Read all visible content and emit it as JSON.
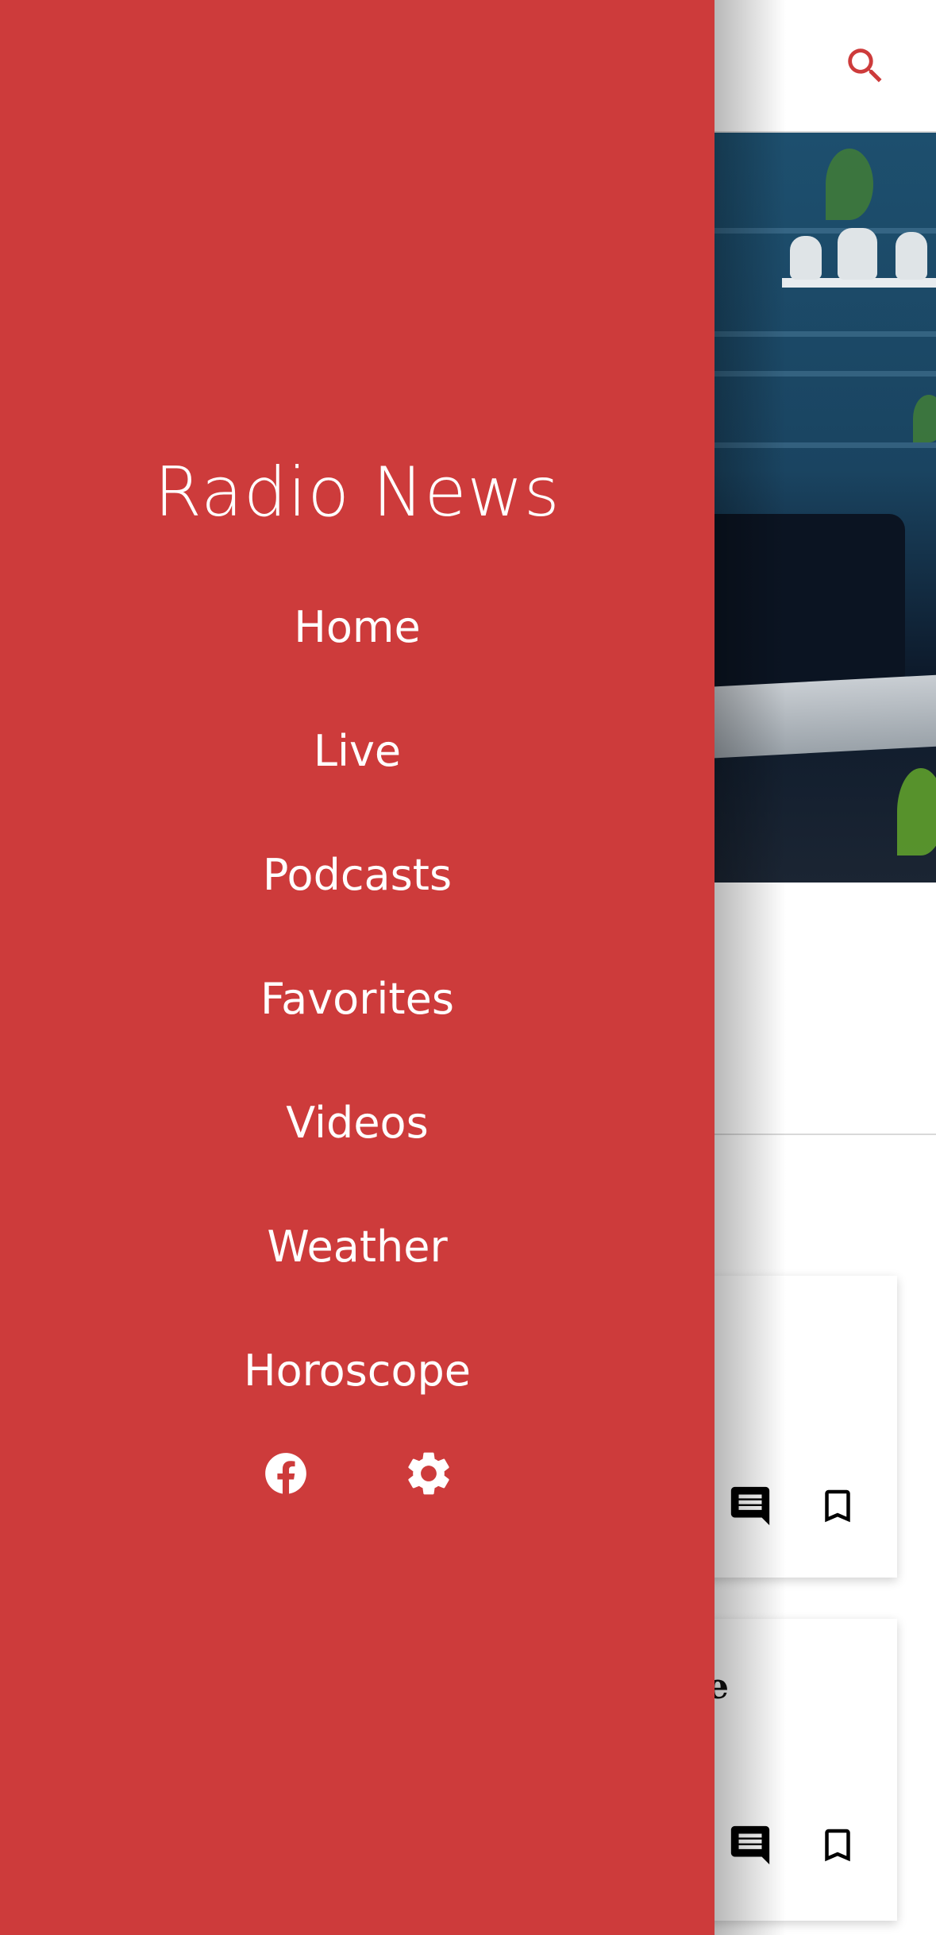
{
  "app": {
    "name": "Radio News",
    "accent_color": "#cd3b3b",
    "icons": {
      "search": "search-icon",
      "comment": "comment-icon",
      "bookmark": "bookmark-icon",
      "facebook": "facebook-icon",
      "settings": "gear-icon"
    }
  },
  "drawer": {
    "title": "Radio News",
    "menu": [
      {
        "label": "Home"
      },
      {
        "label": "Live"
      },
      {
        "label": "Podcasts"
      },
      {
        "label": "Favorites"
      },
      {
        "label": "Videos"
      },
      {
        "label": "Weather"
      },
      {
        "label": "Horoscope"
      }
    ]
  },
  "feed": {
    "cards": [
      {
        "title_fragment": ""
      },
      {
        "title_fragment": "e"
      }
    ]
  }
}
